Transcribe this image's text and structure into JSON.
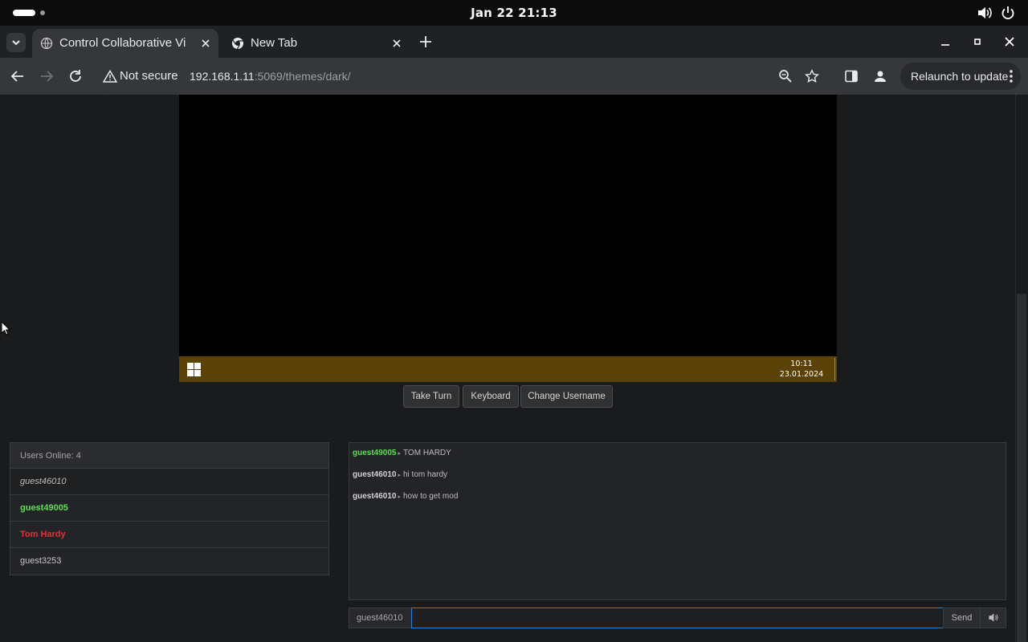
{
  "system": {
    "clock": "Jan 22  21:13"
  },
  "browser": {
    "tabs": [
      {
        "label": "Control Collaborative Vi",
        "active": true
      },
      {
        "label": "New Tab",
        "active": false
      }
    ],
    "security": "Not secure",
    "url_host": "192.168.1.11",
    "url_rest": ":5069/themes/dark/",
    "relaunch_label": "Relaunch to update"
  },
  "vm": {
    "clock_time": "10:11",
    "clock_date": "23.01.2024",
    "taskbar_color": "#5a4206"
  },
  "controls": {
    "take_turn": "Take Turn",
    "keyboard": "Keyboard",
    "change_username": "Change Username"
  },
  "users": {
    "header": "Users Online: 4",
    "list": [
      {
        "name": "guest46010",
        "style": "self"
      },
      {
        "name": "guest49005",
        "style": "green"
      },
      {
        "name": "Tom Hardy",
        "style": "red"
      },
      {
        "name": "guest3253",
        "style": "normal"
      }
    ]
  },
  "chat": {
    "messages": [
      {
        "user": "guest49005",
        "text": "TOM HARDY",
        "highlight": true
      },
      {
        "user": "guest46010",
        "text": "hi tom hardy",
        "highlight": false
      },
      {
        "user": "guest46010",
        "text": "how to get mod",
        "highlight": false
      }
    ],
    "username": "guest46010",
    "input_value": "",
    "send_label": "Send"
  },
  "colors": {
    "accent_green": "#5ae050",
    "accent_red": "#e03236",
    "input_focus": "#2a7fc8"
  }
}
